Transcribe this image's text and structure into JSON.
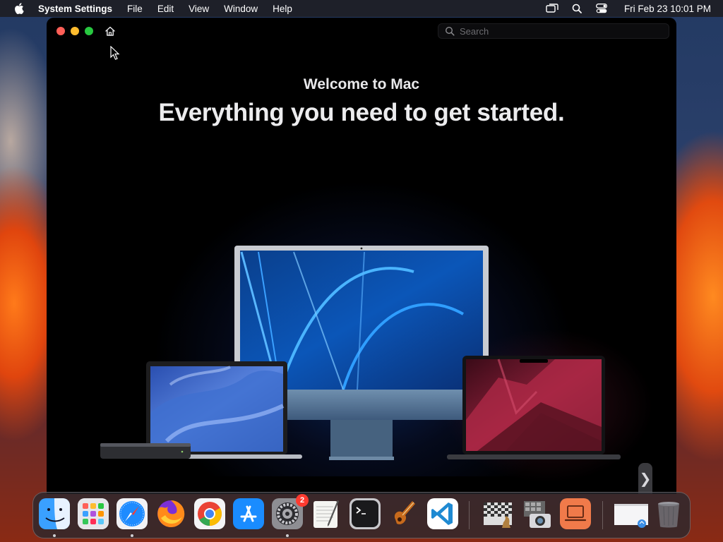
{
  "menubar": {
    "app_name": "System Settings",
    "items": [
      "File",
      "Edit",
      "View",
      "Window",
      "Help"
    ],
    "clock": "Fri Feb 23  10:01 PM",
    "tray_icons": [
      "screen-mirroring-icon",
      "spotlight-search-icon",
      "control-center-icon"
    ]
  },
  "window": {
    "search_placeholder": "Search",
    "welcome_subtitle": "Welcome to Mac",
    "welcome_title": "Everything you need to get started.",
    "next_arrow": "❯"
  },
  "dock": {
    "apps": [
      {
        "name": "Finder",
        "icon": "finder-icon",
        "running": true
      },
      {
        "name": "Launchpad",
        "icon": "launchpad-icon",
        "running": false
      },
      {
        "name": "Safari",
        "icon": "safari-icon",
        "running": true
      },
      {
        "name": "Firefox",
        "icon": "firefox-icon",
        "running": false
      },
      {
        "name": "Google Chrome",
        "icon": "chrome-icon",
        "running": false
      },
      {
        "name": "App Store",
        "icon": "app-store-icon",
        "running": false
      },
      {
        "name": "System Settings",
        "icon": "system-settings-icon",
        "running": true,
        "badge": "2"
      },
      {
        "name": "TextEdit",
        "icon": "textedit-icon",
        "running": false
      },
      {
        "name": "Terminal",
        "icon": "terminal-icon",
        "running": false
      },
      {
        "name": "GarageBand",
        "icon": "garageband-icon",
        "running": false
      },
      {
        "name": "Visual Studio Code",
        "icon": "vscode-icon",
        "running": false
      },
      {
        "name": "Chess",
        "icon": "chess-icon",
        "running": false
      },
      {
        "name": "Image Capture",
        "icon": "image-capture-icon",
        "running": false
      },
      {
        "name": "Screen Sharing",
        "icon": "screen-sharing-icon",
        "running": false
      },
      {
        "name": "Preview window",
        "icon": "minimized-window-icon",
        "running": false
      },
      {
        "name": "Trash",
        "icon": "trash-icon",
        "running": false
      }
    ]
  },
  "colors": {
    "close": "#ff5f57",
    "minimize": "#febc2e",
    "zoom": "#28c840",
    "badge": "#ff3b30"
  }
}
